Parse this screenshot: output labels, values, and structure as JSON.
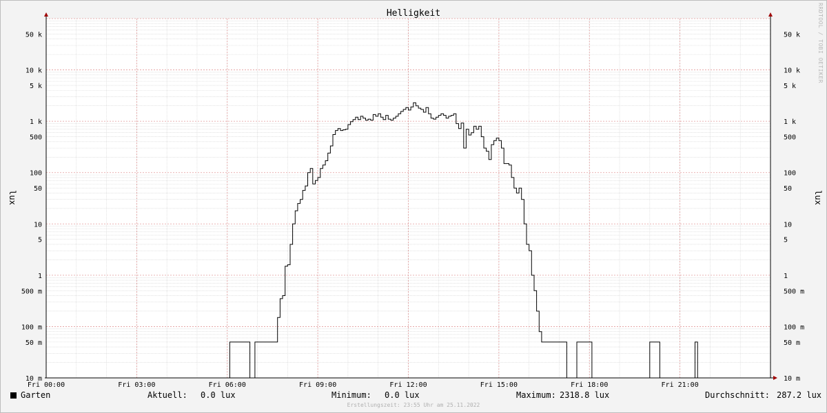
{
  "chart_data": {
    "type": "line",
    "title": "Helligkeit",
    "ylabel": "lux",
    "y_scale": "log",
    "ylim": [
      0.01,
      100000
    ],
    "xlim": [
      "00:00",
      "24:00"
    ],
    "grid": true,
    "y_ticks": [
      {
        "v": 0.01,
        "label": "10 m"
      },
      {
        "v": 0.05,
        "label": "50 m"
      },
      {
        "v": 0.1,
        "label": "100 m"
      },
      {
        "v": 0.5,
        "label": "500 m"
      },
      {
        "v": 1,
        "label": "1"
      },
      {
        "v": 5,
        "label": "5"
      },
      {
        "v": 10,
        "label": "10"
      },
      {
        "v": 50,
        "label": "50"
      },
      {
        "v": 100,
        "label": "100"
      },
      {
        "v": 500,
        "label": "500"
      },
      {
        "v": 1000,
        "label": "1 k"
      },
      {
        "v": 5000,
        "label": "5 k"
      },
      {
        "v": 10000,
        "label": "10 k"
      },
      {
        "v": 50000,
        "label": "50 k"
      }
    ],
    "x_ticks": [
      {
        "t": "00:00",
        "label": "Fri 00:00"
      },
      {
        "t": "03:00",
        "label": "Fri 03:00"
      },
      {
        "t": "06:00",
        "label": "Fri 06:00"
      },
      {
        "t": "09:00",
        "label": "Fri 09:00"
      },
      {
        "t": "12:00",
        "label": "Fri 12:00"
      },
      {
        "t": "15:00",
        "label": "Fri 15:00"
      },
      {
        "t": "18:00",
        "label": "Fri 18:00"
      },
      {
        "t": "21:00",
        "label": "Fri 21:00"
      }
    ],
    "series": [
      {
        "name": "Garten",
        "color": "#000000",
        "points": [
          [
            "00:00",
            0
          ],
          [
            "06:00",
            0
          ],
          [
            "06:05",
            0.05
          ],
          [
            "06:40",
            0.05
          ],
          [
            "06:45",
            0
          ],
          [
            "06:50",
            0
          ],
          [
            "06:55",
            0.05
          ],
          [
            "07:30",
            0.05
          ],
          [
            "07:40",
            0.15
          ],
          [
            "07:45",
            0.35
          ],
          [
            "07:50",
            0.4
          ],
          [
            "07:55",
            1.5
          ],
          [
            "08:00",
            1.6
          ],
          [
            "08:05",
            4
          ],
          [
            "08:10",
            10
          ],
          [
            "08:15",
            18
          ],
          [
            "08:20",
            25
          ],
          [
            "08:25",
            30
          ],
          [
            "08:30",
            45
          ],
          [
            "08:35",
            55
          ],
          [
            "08:40",
            100
          ],
          [
            "08:45",
            120
          ],
          [
            "08:50",
            60
          ],
          [
            "08:55",
            70
          ],
          [
            "09:00",
            80
          ],
          [
            "09:05",
            120
          ],
          [
            "09:10",
            140
          ],
          [
            "09:15",
            170
          ],
          [
            "09:20",
            240
          ],
          [
            "09:25",
            330
          ],
          [
            "09:30",
            550
          ],
          [
            "09:35",
            660
          ],
          [
            "09:40",
            720
          ],
          [
            "09:45",
            660
          ],
          [
            "09:50",
            680
          ],
          [
            "09:55",
            700
          ],
          [
            "10:00",
            860
          ],
          [
            "10:05",
            980
          ],
          [
            "10:10",
            1080
          ],
          [
            "10:15",
            1200
          ],
          [
            "10:20",
            1080
          ],
          [
            "10:25",
            1250
          ],
          [
            "10:30",
            1150
          ],
          [
            "10:35",
            1050
          ],
          [
            "10:40",
            1100
          ],
          [
            "10:45",
            1050
          ],
          [
            "10:50",
            1350
          ],
          [
            "10:55",
            1250
          ],
          [
            "11:00",
            1400
          ],
          [
            "11:05",
            1200
          ],
          [
            "11:10",
            1080
          ],
          [
            "11:15",
            1300
          ],
          [
            "11:20",
            1100
          ],
          [
            "11:25",
            1050
          ],
          [
            "11:30",
            1150
          ],
          [
            "11:35",
            1250
          ],
          [
            "11:40",
            1400
          ],
          [
            "11:45",
            1550
          ],
          [
            "11:50",
            1700
          ],
          [
            "11:55",
            1850
          ],
          [
            "12:00",
            1650
          ],
          [
            "12:05",
            1900
          ],
          [
            "12:10",
            2300
          ],
          [
            "12:15",
            2000
          ],
          [
            "12:20",
            1800
          ],
          [
            "12:25",
            1700
          ],
          [
            "12:30",
            1500
          ],
          [
            "12:35",
            1850
          ],
          [
            "12:40",
            1400
          ],
          [
            "12:45",
            1150
          ],
          [
            "12:50",
            1100
          ],
          [
            "12:55",
            1200
          ],
          [
            "13:00",
            1300
          ],
          [
            "13:05",
            1400
          ],
          [
            "13:10",
            1300
          ],
          [
            "13:15",
            1150
          ],
          [
            "13:20",
            1250
          ],
          [
            "13:25",
            1300
          ],
          [
            "13:30",
            1400
          ],
          [
            "13:35",
            900
          ],
          [
            "13:40",
            720
          ],
          [
            "13:45",
            920
          ],
          [
            "13:50",
            300
          ],
          [
            "13:55",
            700
          ],
          [
            "14:00",
            540
          ],
          [
            "14:05",
            600
          ],
          [
            "14:10",
            800
          ],
          [
            "14:15",
            700
          ],
          [
            "14:20",
            800
          ],
          [
            "14:25",
            500
          ],
          [
            "14:30",
            300
          ],
          [
            "14:35",
            260
          ],
          [
            "14:40",
            180
          ],
          [
            "14:45",
            350
          ],
          [
            "14:50",
            420
          ],
          [
            "14:55",
            470
          ],
          [
            "15:00",
            420
          ],
          [
            "15:05",
            300
          ],
          [
            "15:10",
            150
          ],
          [
            "15:15",
            150
          ],
          [
            "15:20",
            140
          ],
          [
            "15:25",
            80
          ],
          [
            "15:30",
            50
          ],
          [
            "15:35",
            40
          ],
          [
            "15:40",
            50
          ],
          [
            "15:45",
            30
          ],
          [
            "15:50",
            10
          ],
          [
            "15:55",
            4
          ],
          [
            "16:00",
            3
          ],
          [
            "16:05",
            1
          ],
          [
            "16:10",
            0.5
          ],
          [
            "16:15",
            0.2
          ],
          [
            "16:20",
            0.08
          ],
          [
            "16:25",
            0.05
          ],
          [
            "16:55",
            0.05
          ],
          [
            "17:10",
            0.05
          ],
          [
            "17:15",
            0
          ],
          [
            "17:30",
            0
          ],
          [
            "17:35",
            0.05
          ],
          [
            "17:50",
            0.05
          ],
          [
            "18:00",
            0.05
          ],
          [
            "18:05",
            0
          ],
          [
            "19:55",
            0
          ],
          [
            "20:00",
            0.05
          ],
          [
            "20:15",
            0.05
          ],
          [
            "20:20",
            0
          ],
          [
            "21:25",
            0
          ],
          [
            "21:30",
            0.05
          ],
          [
            "21:35",
            0
          ],
          [
            "24:00",
            0
          ]
        ]
      }
    ]
  },
  "legend": {
    "series_name": "Garten",
    "current_label": "Aktuell:",
    "current_value": "0.0 lux",
    "min_label": "Minimum:",
    "min_value": "0.0 lux",
    "max_label": "Maximum:",
    "max_value": "2318.8 lux",
    "avg_label": "Durchschnitt:",
    "avg_value": "287.2 lux"
  },
  "footer": "Erstellungszeit: 23:55 Uhr am 25.11.2022",
  "watermark": "RRDTOOL / TOBI OETIKER",
  "colors": {
    "background": "#f3f3f3",
    "plot_background": "#ffffff",
    "major_grid": "#e29a9a",
    "minor_grid": "#d0d0d0",
    "line": "#000000",
    "axis_arrow": "#a00000"
  }
}
